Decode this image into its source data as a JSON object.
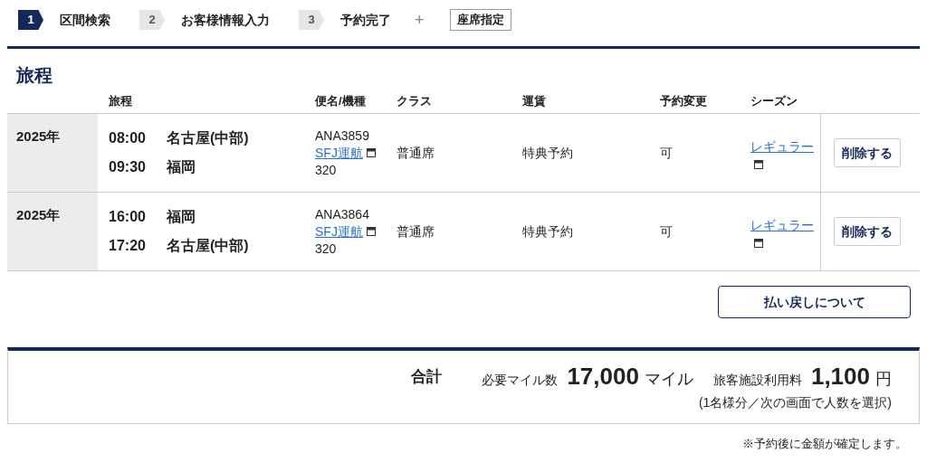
{
  "steps": [
    {
      "number": "1",
      "label": "区間検索",
      "selected": true
    },
    {
      "number": "2",
      "label": "お客様情報入力",
      "selected": false
    },
    {
      "number": "3",
      "label": "予約完了",
      "selected": false
    }
  ],
  "step_plus": "+",
  "seat_step": "座席指定",
  "section_title": "旅程",
  "table": {
    "columns": [
      "旅程",
      "便名/機種",
      "クラス",
      "運賃",
      "予約変更",
      "シーズン"
    ],
    "rows": [
      {
        "date": "2025年",
        "legs": [
          {
            "time": "08:00",
            "airport": "名古屋(中部)"
          },
          {
            "time": "09:30",
            "airport": "福岡"
          }
        ],
        "flight": "ANA3859",
        "operator": "SFJ運航",
        "aircraft": "320",
        "class": "普通席",
        "fare": "特典予約",
        "change": "可",
        "season": "レギュラー",
        "delete_button": "削除する"
      },
      {
        "date": "2025年",
        "legs": [
          {
            "time": "16:00",
            "airport": "福岡"
          },
          {
            "time": "17:20",
            "airport": "名古屋(中部)"
          }
        ],
        "flight": "ANA3864",
        "operator": "SFJ運航",
        "aircraft": "320",
        "class": "普通席",
        "fare": "特典予約",
        "change": "可",
        "season": "レギュラー",
        "delete_button": "削除する"
      }
    ]
  },
  "refund_button": "払い戻しについて",
  "summary": {
    "title": "合計",
    "miles_label": "必要マイル数",
    "miles_value": "17,000",
    "miles_unit": "マイル",
    "fee_label": "旅客施設利用料",
    "fee_value": "1,100",
    "fee_unit": "円",
    "fee_note": "(1名様分／次の画面で人数を選択)"
  },
  "footnote": "※予約後に金額が確定します。"
}
